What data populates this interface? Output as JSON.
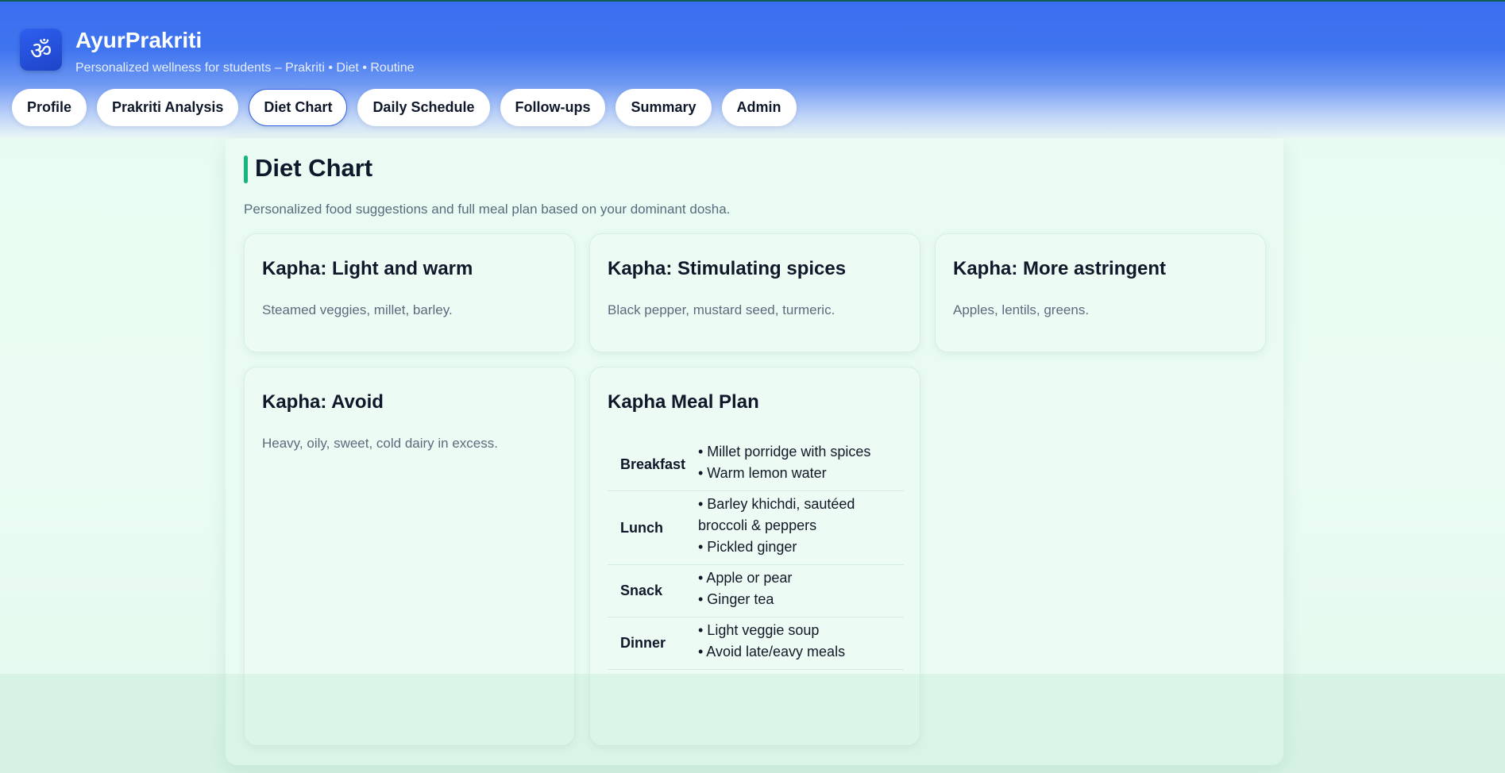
{
  "app": {
    "logo_glyph": "ॐ",
    "title": "AyurPrakriti",
    "subtitle": "Personalized wellness for students – Prakriti • Diet • Routine"
  },
  "nav": {
    "tabs": [
      {
        "label": "Profile"
      },
      {
        "label": "Prakriti Analysis"
      },
      {
        "label": "Diet Chart",
        "active": true
      },
      {
        "label": "Daily Schedule"
      },
      {
        "label": "Follow-ups"
      },
      {
        "label": "Summary"
      },
      {
        "label": "Admin"
      }
    ]
  },
  "section": {
    "title": "Diet Chart",
    "description": "Personalized food suggestions and full meal plan based on your dominant dosha."
  },
  "cards": [
    {
      "title": "Kapha: Light and warm",
      "text": "Steamed veggies, millet, barley."
    },
    {
      "title": "Kapha: Stimulating spices",
      "text": "Black pepper, mustard seed, turmeric."
    },
    {
      "title": "Kapha: More astringent",
      "text": "Apples, lentils, greens."
    },
    {
      "title": "Kapha: Avoid",
      "text": "Heavy, oily, sweet, cold dairy in excess."
    }
  ],
  "meal_plan": {
    "title": "Kapha Meal Plan",
    "rows": [
      {
        "meal": "Breakfast",
        "items": [
          "• Millet porridge with spices",
          "• Warm lemon water"
        ]
      },
      {
        "meal": "Lunch",
        "items": [
          "• Barley khichdi, sautéed broccoli & peppers",
          "• Pickled ginger"
        ]
      },
      {
        "meal": "Snack",
        "items": [
          "• Apple or pear",
          "• Ginger tea"
        ]
      },
      {
        "meal": "Dinner",
        "items": [
          "• Light veggie soup",
          "• Avoid late/eavy meals"
        ]
      }
    ]
  },
  "colors": {
    "header_blue": "#3a6ef0",
    "accent_green": "#16b57a",
    "active_tab_border": "#2f5fe6"
  }
}
